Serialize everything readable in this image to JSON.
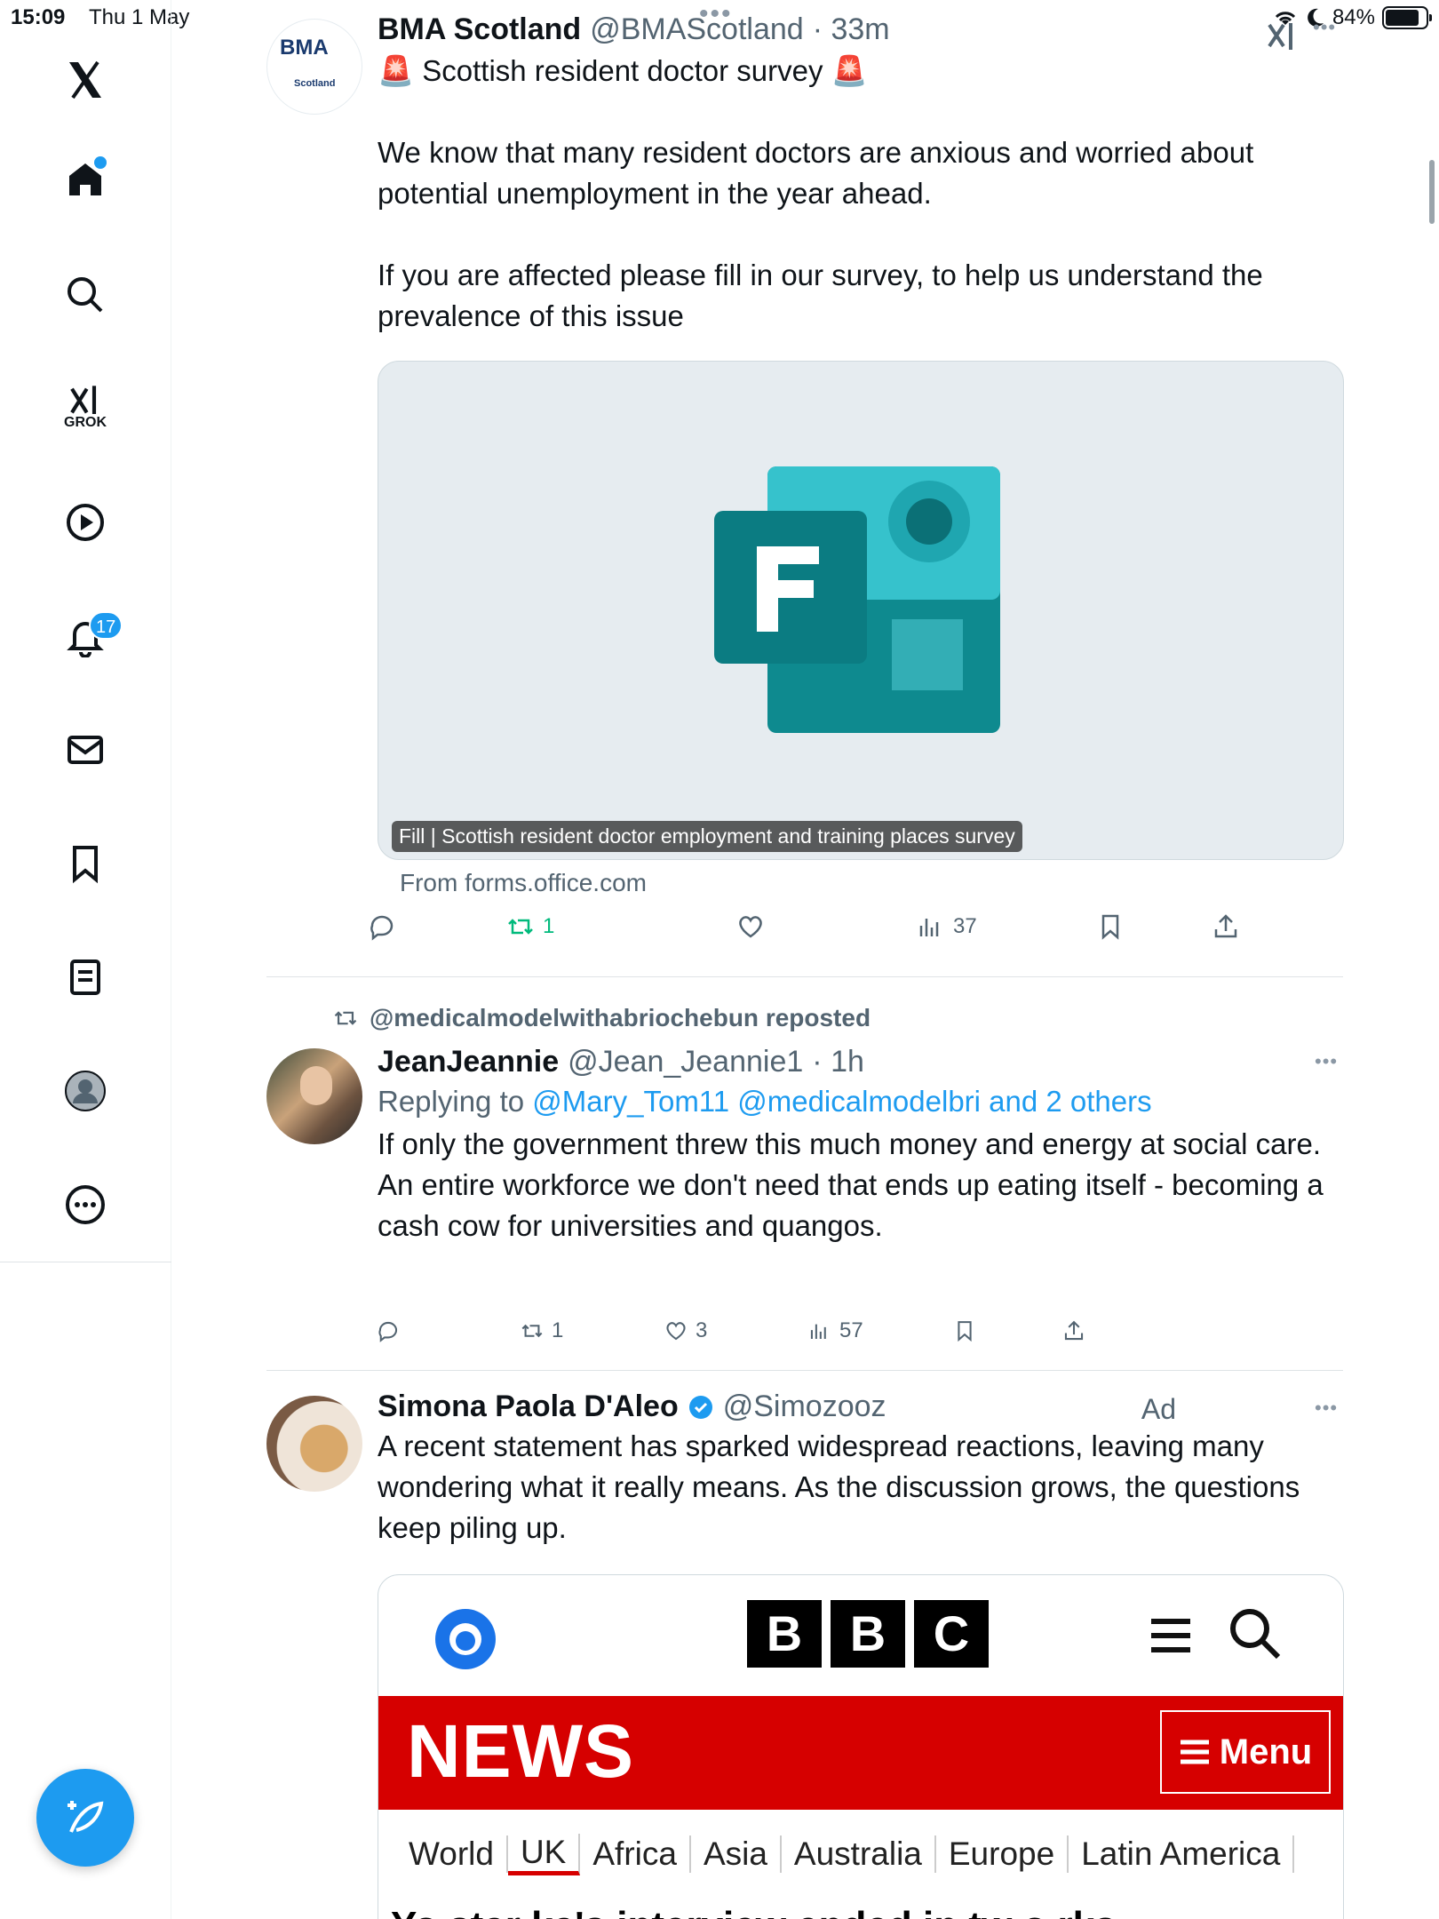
{
  "status_bar": {
    "time": "15:09",
    "date": "Thu 1 May",
    "battery_pct": "84%"
  },
  "sidebar": {
    "notification_count": "17",
    "grok_label": "GROK"
  },
  "posts": [
    {
      "author": "BMA Scotland",
      "handle": "@BMAScotland",
      "time": "· 33m",
      "avatar_text": "BMA",
      "avatar_subtext": "Scotland",
      "title": "🚨 Scottish resident doctor survey 🚨",
      "paragraph1": "We know that many resident doctors are anxious and worried about potential unemployment in the year ahead.",
      "paragraph2": "If you are affected please fill in our survey, to help us understand the prevalence of this issue",
      "card_caption": "Fill | Scottish resident doctor employment and training places survey",
      "card_from": "From forms.office.com",
      "retweets": "1",
      "views": "37"
    },
    {
      "reposted_by": "@medicalmodelwithabriochebun reposted",
      "author": "JeanJeannie",
      "handle": "@Jean_Jeannie1",
      "time": "· 1h",
      "replying_prefix": "Replying to",
      "replying_to": "@Mary_Tom11 @medicalmodelbri and 2 others",
      "text1": "If only the government threw this much money and energy at social care.",
      "text2": "An entire workforce we don't need that ends up eating itself - becoming a cash cow for universities and quangos.",
      "retweets": "1",
      "likes": "3",
      "views": "57"
    },
    {
      "author": "Simona Paola D'Aleo",
      "handle": "@Simozooz",
      "ad_label": "Ad",
      "text": "A recent statement has sparked widespread reactions, leaving many wondering what it really means. As the discussion grows, the questions keep piling up.",
      "bbc": {
        "letters": [
          "B",
          "B",
          "C"
        ],
        "news": "NEWS",
        "menu": "Menu",
        "nav": [
          "World",
          "UK",
          "Africa",
          "Asia",
          "Australia",
          "Europe",
          "Latin America"
        ],
        "headline": "Yo star ka's interview ended in tw o rks"
      }
    }
  ],
  "colors": {
    "accent": "#1d9bf0",
    "retweet_green": "#00ba7c",
    "bbc_red": "#d60000"
  }
}
